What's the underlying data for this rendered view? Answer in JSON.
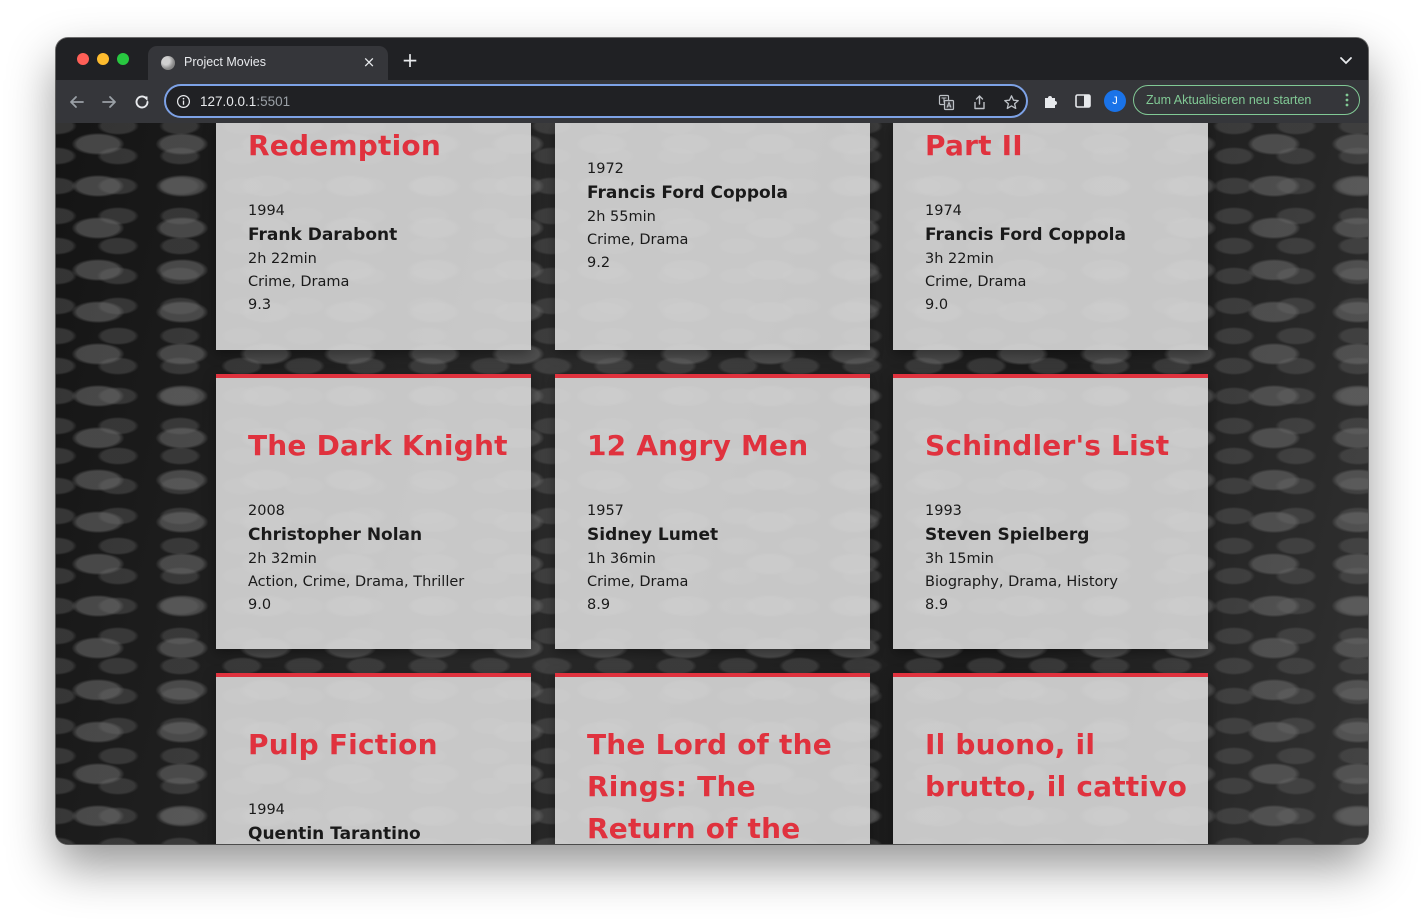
{
  "browser": {
    "tab_title": "Project Movies",
    "tab_close": "×",
    "new_tab": "+",
    "url_host": "127.0.0.1",
    "url_port": ":5501",
    "profile_initial": "J",
    "update_button": "Zum Aktualisieren neu starten"
  },
  "movies": [
    {
      "title": "Redemption",
      "year": "1994",
      "director": "Frank Darabont",
      "runtime": "2h 22min",
      "genres": "Crime, Drama",
      "rating": "9.3"
    },
    {
      "title": "",
      "year": "1972",
      "director": "Francis Ford Coppola",
      "runtime": "2h 55min",
      "genres": "Crime, Drama",
      "rating": "9.2"
    },
    {
      "title": "Part II",
      "year": "1974",
      "director": "Francis Ford Coppola",
      "runtime": "3h 22min",
      "genres": "Crime, Drama",
      "rating": "9.0"
    },
    {
      "title": "The Dark Knight",
      "year": "2008",
      "director": "Christopher Nolan",
      "runtime": "2h 32min",
      "genres": "Action, Crime, Drama, Thriller",
      "rating": "9.0"
    },
    {
      "title": "12 Angry Men",
      "year": "1957",
      "director": "Sidney Lumet",
      "runtime": "1h 36min",
      "genres": "Crime, Drama",
      "rating": "8.9"
    },
    {
      "title": "Schindler's List",
      "year": "1993",
      "director": "Steven Spielberg",
      "runtime": "3h 15min",
      "genres": "Biography, Drama, History",
      "rating": "8.9"
    },
    {
      "title": "Pulp Fiction",
      "year": "1994",
      "director": "Quentin Tarantino",
      "runtime": "",
      "genres": "",
      "rating": ""
    },
    {
      "title": "The Lord of the Rings: The Return of the",
      "year": "",
      "director": "",
      "runtime": "",
      "genres": "",
      "rating": ""
    },
    {
      "title": "Il buono, il brutto, il cattivo",
      "year": "",
      "director": "",
      "runtime": "",
      "genres": "",
      "rating": ""
    }
  ],
  "colors": {
    "accent": "#e0323e",
    "card_bg": "#d6d6d6",
    "update_green": "#81c995"
  }
}
